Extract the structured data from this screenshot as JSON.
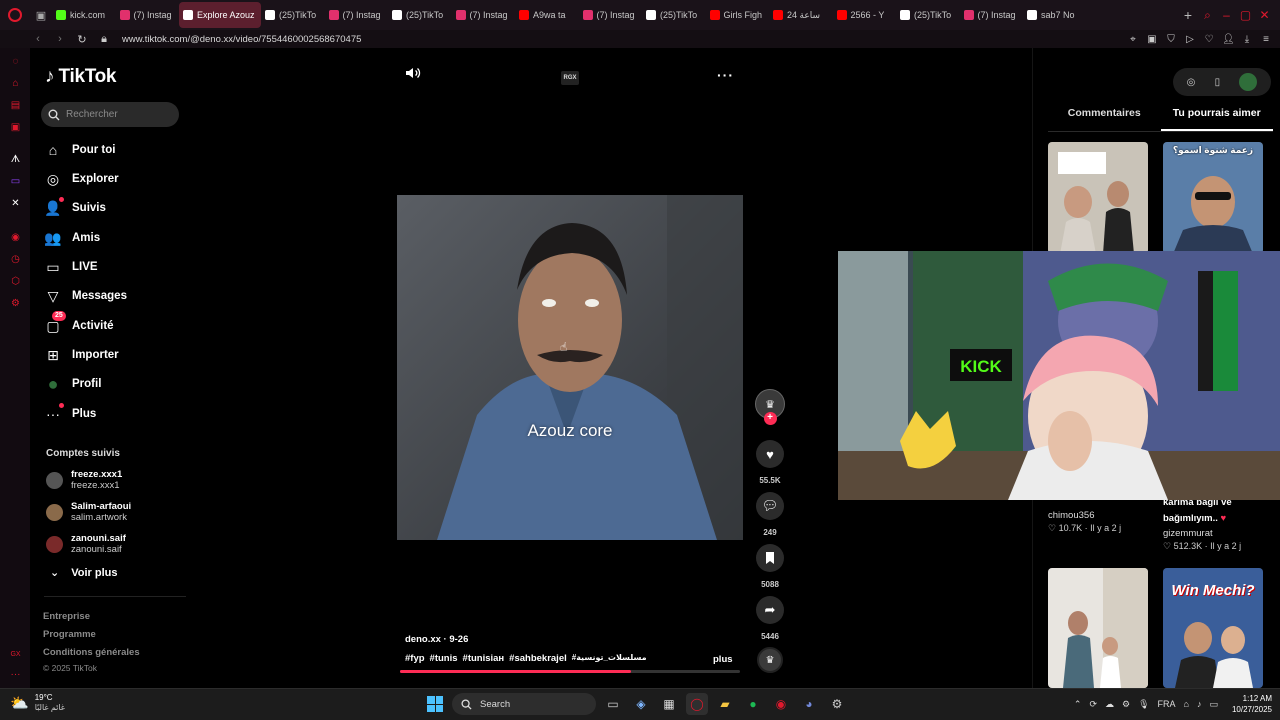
{
  "browser": {
    "tabs": [
      {
        "title": "kick.com",
        "fav_color": "#53fc18",
        "active": false
      },
      {
        "title": "(7) Instag",
        "fav_color": "#e1306c",
        "active": false
      },
      {
        "title": "Explore Azouz C",
        "fav_color": "#ffffff",
        "active": true
      },
      {
        "title": "(25)TikTo",
        "fav_color": "#ffffff",
        "active": false
      },
      {
        "title": "(7) Instag",
        "fav_color": "#e1306c",
        "active": false
      },
      {
        "title": "(25)TikTo",
        "fav_color": "#ffffff",
        "active": false
      },
      {
        "title": "(7) Instag",
        "fav_color": "#e1306c",
        "active": false
      },
      {
        "title": "A9wa ta",
        "fav_color": "#ff0000",
        "active": false
      },
      {
        "title": "(7) Instag",
        "fav_color": "#e1306c",
        "active": false
      },
      {
        "title": "(25)TikTo",
        "fav_color": "#ffffff",
        "active": false
      },
      {
        "title": "Girls Figh",
        "fav_color": "#ff0000",
        "active": false
      },
      {
        "title": "24 ساعة",
        "fav_color": "#ff0000",
        "active": false
      },
      {
        "title": "2566 - Y",
        "fav_color": "#ff0000",
        "active": false
      },
      {
        "title": "(25)TikTo",
        "fav_color": "#ffffff",
        "active": false
      },
      {
        "title": "(7) Instag",
        "fav_color": "#e1306c",
        "active": false
      },
      {
        "title": "sab7 No",
        "fav_color": "#ffffff",
        "active": false
      }
    ],
    "new_tab": "+",
    "url": "www.tiktok.com/@deno.xx/video/7554460002568670475"
  },
  "tiktok": {
    "logo": "TikTok",
    "search_placeholder": "Rechercher",
    "nav": [
      {
        "label": "Pour toi",
        "icon": "home-icon",
        "glyph": "⌂"
      },
      {
        "label": "Explorer",
        "icon": "compass-icon",
        "glyph": "◎"
      },
      {
        "label": "Suivis",
        "icon": "following-icon",
        "glyph": "👤"
      },
      {
        "label": "Amis",
        "icon": "friends-icon",
        "glyph": "👥"
      },
      {
        "label": "LIVE",
        "icon": "live-icon",
        "glyph": "▭"
      },
      {
        "label": "Messages",
        "icon": "messages-icon",
        "glyph": "▽"
      },
      {
        "label": "Activité",
        "icon": "activity-icon",
        "glyph": "▢",
        "badge": "25"
      },
      {
        "label": "Importer",
        "icon": "upload-icon",
        "glyph": "⊞"
      },
      {
        "label": "Profil",
        "icon": "profile-avatar-icon",
        "glyph": "●"
      },
      {
        "label": "Plus",
        "icon": "more-icon",
        "glyph": "···"
      }
    ],
    "followed_title": "Comptes suivis",
    "followed": [
      {
        "name": "freeze.xxx1",
        "handle": "freeze.xxx1"
      },
      {
        "name": "Salim-arfaoui",
        "handle": "salim.artwork"
      },
      {
        "name": "zanouni.saif",
        "handle": "zanouni.saif"
      }
    ],
    "see_more": "Voir plus",
    "footer": [
      "Entreprise",
      "Programme",
      "Conditions générales"
    ],
    "copyright": "© 2025 TikTok"
  },
  "video": {
    "overlay_logo": "RGX",
    "caption": "Azouz core",
    "author_line": "deno.xx · 9-26",
    "hashtags": [
      "#fyp",
      "#tunis",
      "#tunisiaн",
      "#sahbekrajel",
      "#مسلسلات_تونسية"
    ],
    "more_link": "plus",
    "progress": 0.68,
    "likes": "55.5K",
    "comments": "249",
    "saves": "5088",
    "shares": "5446"
  },
  "side_panel": {
    "tabs": [
      "Commentaires",
      "Tu pourrais aimer"
    ],
    "active_tab": 1,
    "thumb_top_text": "زعمة شنوة اسمو؟",
    "rec_left": {
      "author": "chimou356",
      "likes": "10.7K",
      "age": "Il y a 2 j"
    },
    "rec_right": {
      "title_line1": "karima bağlı ve",
      "title_line2": "bağımlıyım..",
      "author": "gizemmurat",
      "likes": "512.3K",
      "age": "Il y a 2 j"
    },
    "thumb4_text": "Win Mechi?"
  },
  "webcam": {
    "sign": "KICK"
  },
  "taskbar": {
    "temp": "19°C",
    "weather": "غائم غالبًا",
    "search": "Search",
    "lang": "FRA",
    "time": "1:12 AM",
    "date": "10/27/2025"
  },
  "colors": {
    "tiktok_red": "#fe2c55",
    "opera_red": "#e0192d",
    "kick_green": "#53fc18"
  }
}
